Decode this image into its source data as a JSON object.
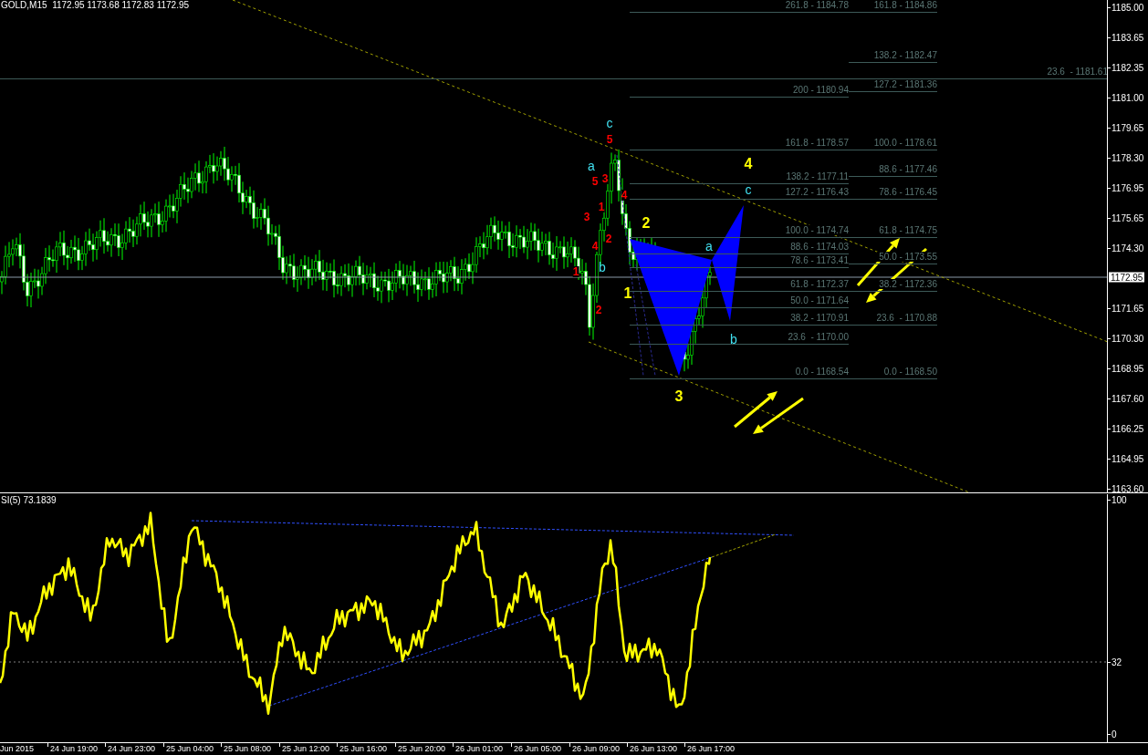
{
  "header": {
    "symbol_info": "GOLD,M15  1172.95 1173.68 1172.83 1172.95"
  },
  "price_axis": {
    "ticks": [
      "1185.00",
      "1183.65",
      "1182.35",
      "1181.00",
      "1179.65",
      "1178.30",
      "1176.95",
      "1175.65",
      "1174.30",
      "1171.65",
      "1170.30",
      "1168.95",
      "1167.60",
      "1166.25",
      "1164.95",
      "1163.60"
    ],
    "current_price": "1172.95"
  },
  "fibonacci_sets": [
    {
      "levels": [
        "261.8 - 1184.78",
        "200 - 1180.94",
        "161.8 - 1178.57",
        "138.2 - 1177.11",
        "127.2 - 1176.43",
        "100.0 - 1174.74",
        "88.6 - 1174.03",
        "78.6 - 1173.41",
        "61.8 - 1172.37",
        "50.0 - 1171.64",
        "38.2 - 1170.91",
        "23.6  - 1170.00",
        "0.0 - 1168.54"
      ]
    },
    {
      "levels": [
        "161.8 - 1184.86",
        "138.2 - 1182.47",
        "127.2 - 1181.36",
        "100.0 - 1178.61",
        "88.6 - 1177.46",
        "78.6 - 1176.45",
        "61.8 - 1174.75",
        "50.0 - 1173.55",
        "38.2 - 1172.36",
        "23.6  - 1170.88",
        "0.0 - 1168.50"
      ]
    },
    {
      "levels": [
        "23.6  - 1181.61"
      ]
    }
  ],
  "wave_labels": [
    {
      "text": "c",
      "kind": "corrective",
      "color": "#40e0f0"
    },
    {
      "text": "5",
      "kind": "minor",
      "color": "#ff0000"
    },
    {
      "text": "a",
      "kind": "corrective",
      "color": "#40e0f0"
    },
    {
      "text": "5",
      "kind": "minor",
      "color": "#ff0000"
    },
    {
      "text": "3",
      "kind": "minor",
      "color": "#ff0000"
    },
    {
      "text": "4",
      "kind": "minor",
      "color": "#ff0000"
    },
    {
      "text": "1",
      "kind": "minor",
      "color": "#ff0000"
    },
    {
      "text": "3",
      "kind": "minor",
      "color": "#ff0000"
    },
    {
      "text": "2",
      "kind": "minor",
      "color": "#ff0000"
    },
    {
      "text": "4",
      "kind": "minor",
      "color": "#ff0000"
    },
    {
      "text": "b",
      "kind": "corrective",
      "color": "#40e0f0"
    },
    {
      "text": "1",
      "kind": "minor",
      "color": "#ff0000"
    },
    {
      "text": "2",
      "kind": "minor",
      "color": "#ff0000"
    },
    {
      "text": "2",
      "kind": "impulse",
      "color": "#ffff00"
    },
    {
      "text": "1",
      "kind": "impulse",
      "color": "#ffff00"
    },
    {
      "text": "3",
      "kind": "impulse",
      "color": "#ffff00"
    },
    {
      "text": "4",
      "kind": "impulse",
      "color": "#ffff00"
    },
    {
      "text": "c",
      "kind": "corrective",
      "color": "#40e0f0"
    },
    {
      "text": "a",
      "kind": "corrective",
      "color": "#40e0f0"
    },
    {
      "text": "b",
      "kind": "corrective",
      "color": "#40e0f0"
    }
  ],
  "rsi_panel": {
    "label": "SI(5) 73.1839",
    "axis_ticks": [
      "100",
      "32",
      "0"
    ]
  },
  "time_axis": {
    "ticks": [
      "Jun 2015",
      "24 Jun 19:00",
      "24 Jun 23:00",
      "25 Jun 04:00",
      "25 Jun 08:00",
      "25 Jun 12:00",
      "25 Jun 16:00",
      "25 Jun 20:00",
      "26 Jun 01:00",
      "26 Jun 05:00",
      "26 Jun 09:00",
      "26 Jun 13:00",
      "26 Jun 17:00"
    ]
  }
}
